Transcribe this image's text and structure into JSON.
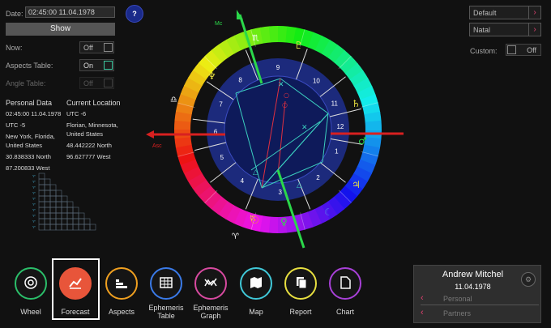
{
  "left_panel": {
    "date_label": "Date:",
    "date_value": "02:45:00 11.04.1978",
    "show_button": "Show",
    "now_label": "Now:",
    "now_state": "Off",
    "aspects_label": "Aspects Table:",
    "aspects_state": "On",
    "angle_label": "Angle Table:",
    "angle_state": "Off",
    "personal_header": "Personal Data",
    "current_header": "Current Location",
    "personal": [
      "02:45:00 11.04.1978",
      "UTC -5",
      "New York, Florida,",
      "United States",
      "30.838333 North",
      "87.200833 West"
    ],
    "current": [
      "UTC -6",
      "Florian, Minnesota,",
      "United States",
      "48.442222 North",
      "96.627777 West"
    ]
  },
  "help_icon_text": "?",
  "right_panel": {
    "dropdown1": "Default",
    "dropdown2": "Natal",
    "custom_label": "Custom:",
    "custom_state": "Off"
  },
  "chart_markers": {
    "mc": "Mc",
    "asc": "Asc"
  },
  "houses": [
    "1",
    "2",
    "3",
    "4",
    "5",
    "6",
    "7",
    "8",
    "9",
    "10",
    "11",
    "12"
  ],
  "toolbar": [
    {
      "label": "Wheel",
      "color": "#2bbf6a",
      "icon": "wheel-icon"
    },
    {
      "label": "Forecast",
      "color": "#e8553a",
      "icon": "forecast-icon"
    },
    {
      "label": "Aspects",
      "color": "#f0a020",
      "icon": "aspects-icon"
    },
    {
      "label": "Ephemeris\nTable",
      "color": "#3a7ae8",
      "icon": "ephemeris-table-icon"
    },
    {
      "label": "Ephemeris\nGraph",
      "color": "#d84aa0",
      "icon": "ephemeris-graph-icon"
    },
    {
      "label": "Map",
      "color": "#40c8d8",
      "icon": "map-icon"
    },
    {
      "label": "Report",
      "color": "#e8e040",
      "icon": "report-icon"
    },
    {
      "label": "Chart",
      "color": "#a840d8",
      "icon": "chart-icon"
    }
  ],
  "profile": {
    "name": "Andrew Mitchel",
    "date": "11.04.1978",
    "personal": "Personal",
    "partners": "Partners"
  },
  "colors": {
    "accent": "#e04070",
    "selected_frame": "#ffffff"
  }
}
